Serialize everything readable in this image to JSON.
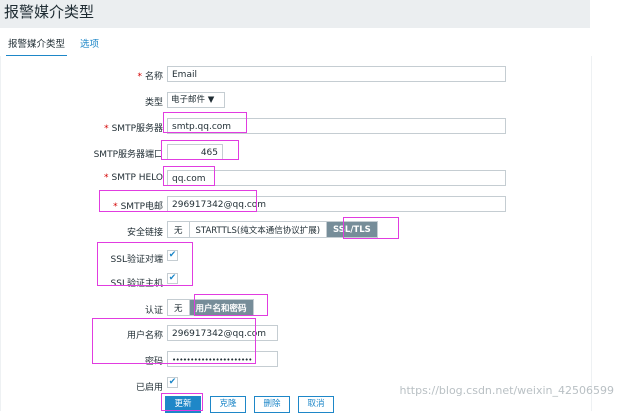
{
  "page": {
    "title": "报警媒介类型"
  },
  "tabs": [
    {
      "label": "报警媒介类型"
    },
    {
      "label": "选项"
    }
  ],
  "form": {
    "name": {
      "label": "名称",
      "value": "Email"
    },
    "type": {
      "label": "类型",
      "value": "电子邮件"
    },
    "smtp_server": {
      "label": "SMTP服务器",
      "value": "smtp.qq.com"
    },
    "smtp_port": {
      "label": "SMTP服务器端口",
      "value": "465"
    },
    "smtp_helo": {
      "label": "SMTP HELO",
      "value": "qq.com"
    },
    "smtp_email": {
      "label": "SMTP电邮",
      "value": "296917342@qq.com"
    },
    "security": {
      "label": "安全链接",
      "options": [
        "无",
        "STARTTLS(纯文本通信协议扩展)",
        "SSL/TLS"
      ],
      "selected": "SSL/TLS"
    },
    "ssl_verify_peer": {
      "label": "SSL验证对端",
      "checked": true
    },
    "ssl_verify_host": {
      "label": "SSL验证主机",
      "checked": true
    },
    "auth": {
      "label": "认证",
      "options": [
        "无",
        "用户名和密码"
      ],
      "selected": "用户名和密码"
    },
    "username": {
      "label": "用户名称",
      "value": "296917342@qq.com"
    },
    "password": {
      "label": "密码",
      "value": "••••••••••••••••••••••"
    },
    "enabled": {
      "label": "已启用",
      "checked": true
    }
  },
  "buttons": {
    "update": "更新",
    "clone": "克隆",
    "delete": "删除",
    "cancel": "取消"
  },
  "watermark": "https://blog.csdn.net/weixin_42506599",
  "colors": {
    "accent": "#1e87c8",
    "highlight": "#e13ce0",
    "required": "#d40000",
    "segment_on": "#768d99"
  }
}
